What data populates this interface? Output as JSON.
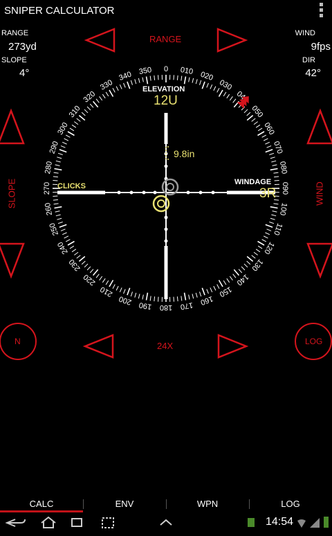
{
  "app": {
    "title": "SNIPER CALCULATOR"
  },
  "range": {
    "label": "RANGE",
    "value": "273",
    "unit": "yd",
    "center_label": "RANGE"
  },
  "slope": {
    "label": "SLOPE",
    "value": "4",
    "unit": "°",
    "side_label": "SLOPE"
  },
  "wind": {
    "label": "WIND",
    "value": "9",
    "unit": "fps",
    "side_label": "WIND"
  },
  "dir": {
    "label": "DIR",
    "value": "42",
    "unit": "°"
  },
  "reticle": {
    "elevation_label": "ELEVATION",
    "elevation_value": "12U",
    "windage_label": "WINDAGE",
    "windage_value": "3R",
    "clicks_label": "CLICKS",
    "drop_value": "9.8in",
    "wind_direction_deg": 42,
    "compass_labels": [
      "0",
      "010",
      "020",
      "030",
      "040",
      "050",
      "060",
      "070",
      "080",
      "090",
      "100",
      "110",
      "120",
      "130",
      "140",
      "150",
      "160",
      "170",
      "180",
      "190",
      "200",
      "210",
      "220",
      "230",
      "240",
      "250",
      "260",
      "270",
      "280",
      "290",
      "300",
      "310",
      "320",
      "330",
      "340",
      "350"
    ]
  },
  "zoom": {
    "value": "24X"
  },
  "buttons": {
    "north": "N",
    "log": "LOG"
  },
  "tabs": [
    {
      "label": "CALC",
      "active": true
    },
    {
      "label": "ENV",
      "active": false
    },
    {
      "label": "WPN",
      "active": false
    },
    {
      "label": "LOG",
      "active": false
    }
  ],
  "status": {
    "time": "14:54"
  },
  "colors": {
    "accent": "#d4141c",
    "reticle_yellow": "#e8e070",
    "reticle_white": "#ffffff"
  }
}
